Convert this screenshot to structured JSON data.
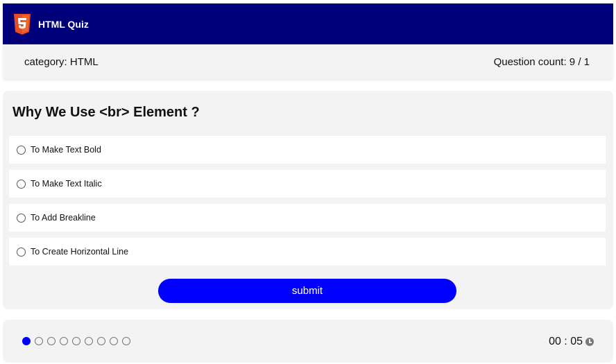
{
  "header": {
    "title": "HTML Quiz",
    "logo_icon": "html5-icon",
    "background": "#00007a"
  },
  "info": {
    "category": "category: HTML",
    "question_count": "Question count: 9 / 1"
  },
  "quiz": {
    "question": "Why We Use <br> Element ?",
    "options": [
      {
        "label": "To Make Text Bold",
        "selected": false
      },
      {
        "label": "To Make Text Italic",
        "selected": false
      },
      {
        "label": "To Add Breakline",
        "selected": false
      },
      {
        "label": "To Create Horizontal Line",
        "selected": false
      }
    ],
    "submit_label": "submit",
    "accent": "#0000ff"
  },
  "footer": {
    "progress_total": 9,
    "progress_current": 1,
    "timer": "00 : 05",
    "timer_icon": "clock-icon"
  }
}
